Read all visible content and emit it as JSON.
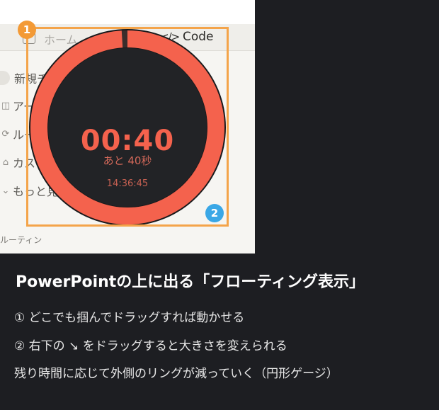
{
  "app": {
    "nav": {
      "home_label": "ホーム",
      "code_icon": "</>",
      "code_label": "Code"
    },
    "sidebar": {
      "items": [
        {
          "icon": "plus-circle-icon",
          "label": "新規チャット"
        },
        {
          "icon": "artifact-icon",
          "label": "アーティファクト"
        },
        {
          "icon": "routine-icon",
          "label": "ルーティン"
        },
        {
          "icon": "customize-icon",
          "label": "カスタマイズ"
        },
        {
          "icon": "more-icon",
          "label": "もっと見る"
        }
      ],
      "section_label": "ルーティン"
    }
  },
  "badges": {
    "one": "1",
    "two": "2"
  },
  "timer": {
    "display": "00:40",
    "remaining": "あと 40秒",
    "clock": "14:36:45",
    "progress": 0.99,
    "ring_color": "#f4624d",
    "face_color": "#222326",
    "text_color": "#f4624d"
  },
  "caption": {
    "title": "PowerPointの上に出る「フローティング表示」",
    "line1": "① どこでも掴んでドラッグすれば動かせる",
    "line2": "② 右下の ↘ をドラッグすると大きさを変えられる",
    "line3": "残り時間に応じて外側のリングが減っていく（円形ゲージ）"
  },
  "colors": {
    "annotation": "#f4a44a",
    "badge1": "#f39a36",
    "badge2": "#3aa7e6",
    "panel": "#1d1e22"
  }
}
